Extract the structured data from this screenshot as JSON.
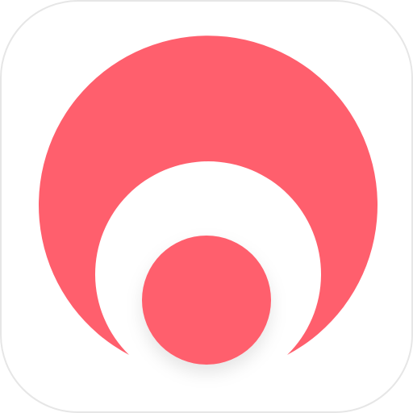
{
  "icon": {
    "name": "app-icon",
    "shape": "rounded-square",
    "background_color": "#ffffff",
    "border_color": "#e6e6e6",
    "accent_color": "#ff5f6d",
    "shadow_color": "#000000",
    "glyph": "crescent-arc-with-dot"
  }
}
